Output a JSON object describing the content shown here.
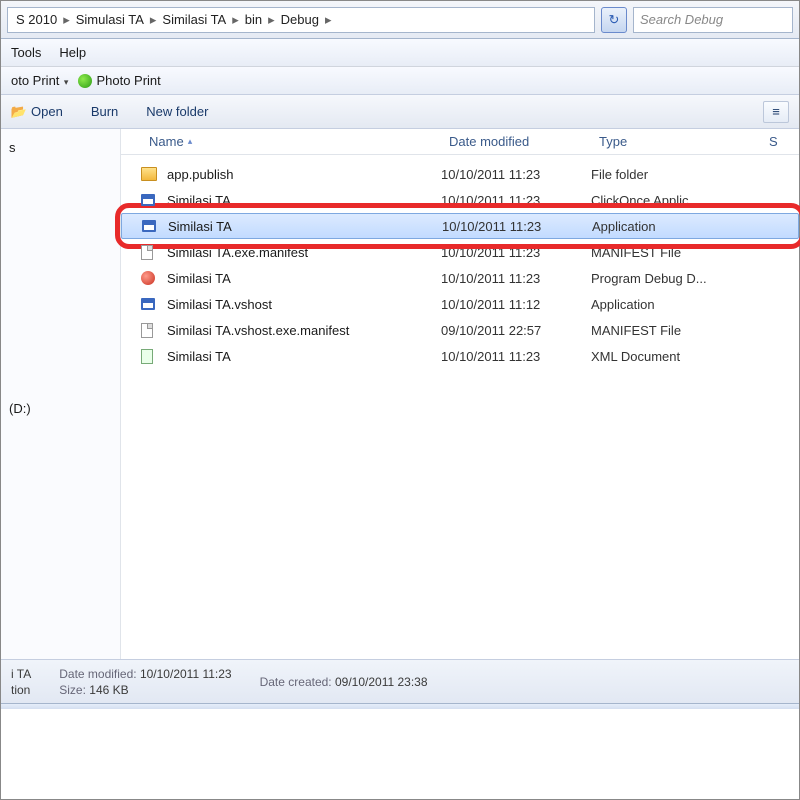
{
  "breadcrumb": {
    "items": [
      "S 2010",
      "Simulasi TA",
      "Similasi TA",
      "bin",
      "Debug"
    ]
  },
  "search": {
    "placeholder": "Search Debug"
  },
  "menubar": {
    "tools": "Tools",
    "help": "Help"
  },
  "toolbar2": {
    "photoPrint1": "oto Print",
    "photoPrint2": "Photo Print"
  },
  "toolbar3": {
    "open": "Open",
    "burn": "Burn",
    "newfolder": "New folder"
  },
  "sidebar": {
    "items": [
      "s",
      "(D:)"
    ]
  },
  "columns": {
    "name": "Name",
    "date": "Date modified",
    "type": "Type",
    "size": "S"
  },
  "files": [
    {
      "name": "app.publish",
      "date": "10/10/2011 11:23",
      "type": "File folder",
      "icon": "folder"
    },
    {
      "name": "Similasi TA",
      "date": "10/10/2011 11:23",
      "type": "ClickOnce Applic...",
      "icon": "app"
    },
    {
      "name": "Similasi TA",
      "date": "10/10/2011 11:23",
      "type": "Application",
      "icon": "app",
      "selected": true
    },
    {
      "name": "Similasi TA.exe.manifest",
      "date": "10/10/2011 11:23",
      "type": "MANIFEST File",
      "icon": "file"
    },
    {
      "name": "Similasi TA",
      "date": "10/10/2011 11:23",
      "type": "Program Debug D...",
      "icon": "red"
    },
    {
      "name": "Similasi TA.vshost",
      "date": "10/10/2011 11:12",
      "type": "Application",
      "icon": "app"
    },
    {
      "name": "Similasi TA.vshost.exe.manifest",
      "date": "09/10/2011 22:57",
      "type": "MANIFEST File",
      "icon": "file"
    },
    {
      "name": "Similasi TA",
      "date": "10/10/2011 11:23",
      "type": "XML Document",
      "icon": "xml"
    }
  ],
  "status": {
    "fileName": "i TA",
    "fileType": "tion",
    "dateModLabel": "Date modified:",
    "dateMod": "10/10/2011 11:23",
    "sizeLabel": "Size:",
    "size": "146 KB",
    "dateCreatedLabel": "Date created:",
    "dateCreated": "09/10/2011 23:38"
  }
}
